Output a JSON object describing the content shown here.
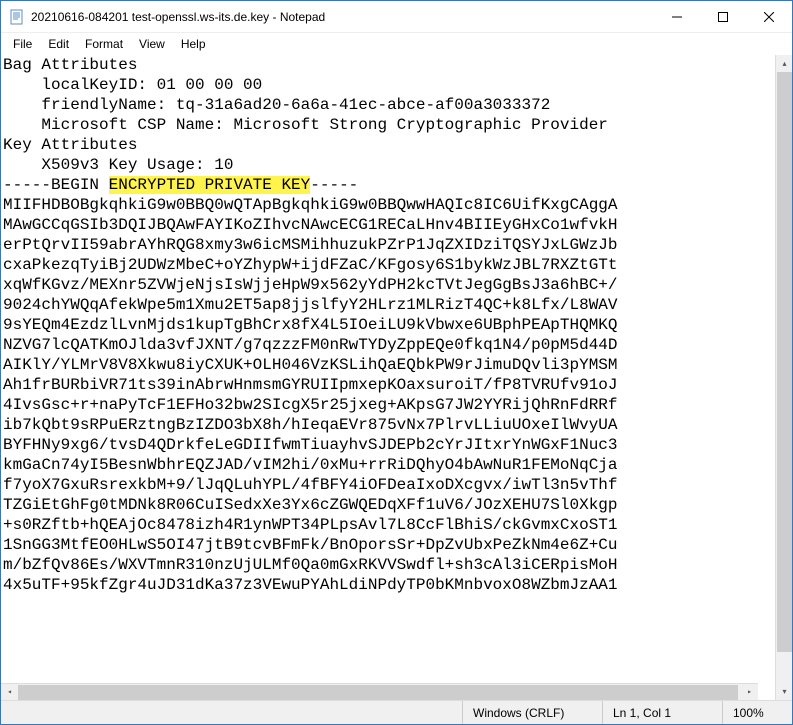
{
  "window": {
    "title": "20210616-084201 test-openssl.ws-its.de.key - Notepad"
  },
  "menu": {
    "file": "File",
    "edit": "Edit",
    "format": "Format",
    "view": "View",
    "help": "Help"
  },
  "content": {
    "before_highlight": "Bag Attributes\n    localKeyID: 01 00 00 00 \n    friendlyName: tq-31a6ad20-6a6a-41ec-abce-af00a3033372\n    Microsoft CSP Name: Microsoft Strong Cryptographic Provider\nKey Attributes\n    X509v3 Key Usage: 10 \n-----BEGIN ",
    "highlight": "ENCRYPTED PRIVATE KEY",
    "after_highlight": "-----\nMIIFHDBOBgkqhkiG9w0BBQ0wQTApBgkqhkiG9w0BBQwwHAQIc8IC6UifKxgCAggA\nMAwGCCqGSIb3DQIJBQAwFAYIKoZIhvcNAwcECG1RECaLHnv4BIIEyGHxCo1wfvkH\nerPtQrvII59abrAYhRQG8xmy3w6icMSMihhuzukPZrP1JqZXIDziTQSYJxLGWzJb\ncxaPkezqTyiBj2UDWzMbeC+oYZhypW+ijdFZaC/KFgosy6S1bykWzJBL7RXZtGTt\nxqWfKGvz/MEXnr5ZVWjeNjsIsWjjeHpW9x562yYdPH2kcTVtJegGgBsJ3a6hBC+/\n9024chYWQqAfekWpe5m1Xmu2ET5ap8jjslfyY2HLrz1MLRizT4QC+k8Lfx/L8WAV\n9sYEQm4EzdzlLvnMjds1kupTgBhCrx8fX4L5IOeiLU9kVbwxe6UBphPEApTHQMKQ\nNZVG7lcQATKmOJlda3vfJXNT/g7qzzzFM0nRwTYDyZppEQe0fkq1N4/p0pM5d44D\nAIKlY/YLMrV8V8Xkwu8iyCXUK+OLH046VzKSLihQaEQbkPW9rJimuDQvli3pYMSM\nAh1frBURbiVR71ts39inAbrwHnmsmGYRUIIpmxepKOaxsuroiT/fP8TVRUfv91oJ\n4IvsGsc+r+naPyTcF1EFHo32bw2SIcgX5r25jxeg+AKpsG7JW2YYRijQhRnFdRRf\nib7kQbt9sRPuERztngBzIZDO3bX8h/hIeqaEVr875vNx7PlrvLLiuUOxeIlWvyUA\nBYFHNy9xg6/tvsD4QDrkfeLeGDIIfwmTiuayhvSJDEPb2cYrJItxrYnWGxF1Nuc3\nkmGaCn74yI5BesnWbhrEQZJAD/vIM2hi/0xMu+rrRiDQhyO4bAwNuR1FEMoNqCja\nf7yoX7GxuRsrexkbM+9/lJqQLuhYPL/4fBFY4iOFDeaIxoDXcgvx/iwTl3n5vThf\nTZGiEtGhFg0tMDNk8R06CuISedxXe3Yx6cZGWQEDqXFf1uV6/JOzXEHU7Sl0Xkgp\n+s0RZftb+hQEAjOc8478izh4R1ynWPT34PLpsAvl7L8CcFlBhiS/ckGvmxCxoST1\n1SnGG3MtfEO0HLwS5OI47jtB9tcvBFmFk/BnOporsSr+DpZvUbxPeZkNm4e6Z+Cu\nm/bZfQv86Es/WXVTmnR310nzUjULMf0Qa0mGxRKVVSwdfl+sh3cAl3iCERpisMoH\n4x5uTF+95kfZgr4uJD31dKa37z3VEwuPYAhLdiNPdyTP0bKMnbvoxO8WZbmJzAA1"
  },
  "status": {
    "encoding": "Windows (CRLF)",
    "position": "Ln 1, Col 1",
    "zoom": "100%"
  }
}
